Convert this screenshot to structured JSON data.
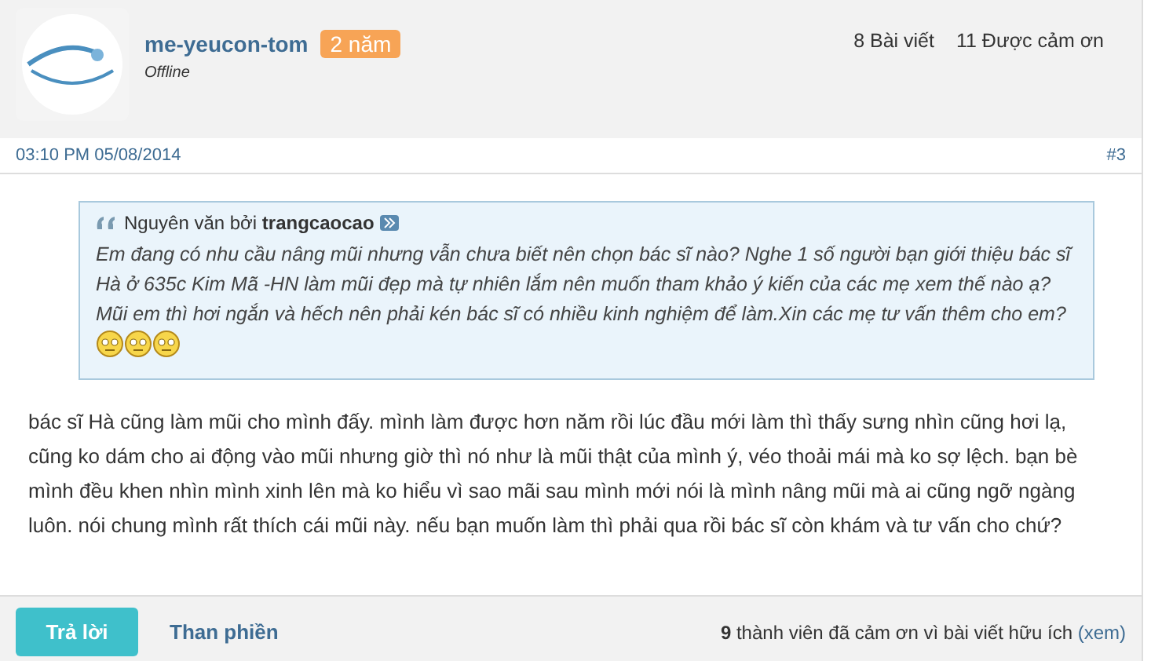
{
  "author": {
    "username": "me-yeucon-tom",
    "badge": "2 năm",
    "status": "Offline",
    "stats": [
      "8 Bài viết",
      "11 Được cảm ơn"
    ]
  },
  "post_meta": {
    "date": "03:10 PM 05/08/2014",
    "number": "#3"
  },
  "quote": {
    "prefix": "Nguyên văn bởi",
    "author": "trangcaocao",
    "text": "Em đang có nhu cầu nâng mũi nhưng vẫn chưa biết nên chọn bác sĩ nào? Nghe 1 số người bạn giới thiệu bác sĩ Hà ở 635c Kim Mã -HN làm mũi đẹp mà tự nhiên lắm nên muốn tham khảo ý kiến của các mẹ xem thế nào ạ? Mũi em thì hơi ngắn và hếch nên phải kén bác sĩ có nhiều kinh nghiệm để làm.Xin các mẹ tư vấn thêm cho em?",
    "emoticons": [
      {
        "kind": "smiley"
      },
      {
        "kind": "smiley"
      },
      {
        "kind": "smiley"
      }
    ]
  },
  "body": "bác sĩ Hà cũng làm mũi cho mình đấy. mình làm được hơn năm rồi lúc đầu mới làm thì thấy sưng nhìn cũng hơi lạ, cũng ko dám cho ai động vào mũi nhưng giờ thì nó như là mũi thật của mình ý, véo thoải mái mà ko sợ lệch. bạn bè mình đều khen nhìn mình xinh lên mà ko hiểu vì sao mãi sau mình mới nói là mình nâng mũi mà ai cũng ngỡ ngàng luôn. nói chung mình rất thích cái mũi này. nếu bạn muốn làm thì phải qua rồi bác sĩ còn khám và tư vấn cho chứ?",
  "footer": {
    "reply_button": "Trả lời",
    "report_link": "Than phiền",
    "thanks_count": "9",
    "thanks_text": "thành viên đã cảm ơn vì bài viết hữu ích",
    "thanks_link": "(xem)"
  }
}
